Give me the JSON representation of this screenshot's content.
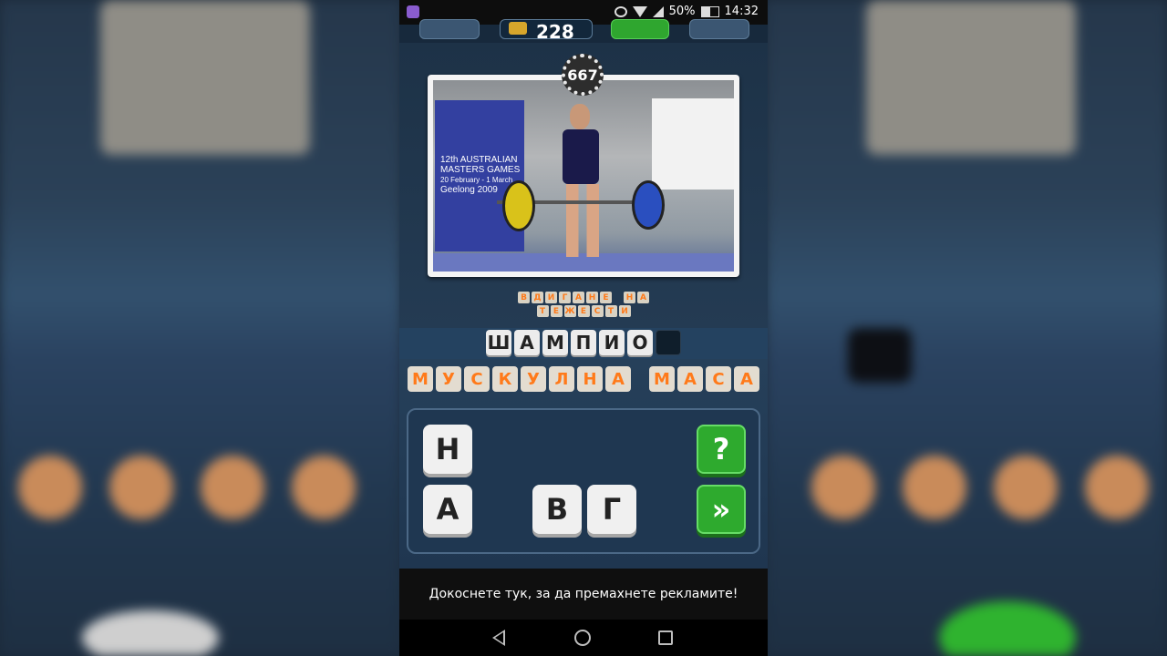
{
  "status_bar": {
    "battery": "50%",
    "time": "14:32"
  },
  "header": {
    "coins": "228",
    "add_label": "+"
  },
  "level": {
    "number": "667"
  },
  "photo": {
    "banner_lines": [
      "12th AUSTRALIAN",
      "MASTERS GAMES",
      "20 February - 1 March",
      "Geelong 2009"
    ]
  },
  "clue_words": [
    [
      "В",
      "Д",
      "И",
      "Г",
      "А",
      "Н",
      "Е",
      " ",
      "Н",
      "А"
    ],
    [
      "Т",
      "Е",
      "Ж",
      "Е",
      "С",
      "Т",
      "И"
    ]
  ],
  "answer_letters": [
    "Ш",
    "А",
    "М",
    "П",
    "И",
    "О"
  ],
  "guessed_words": [
    "М",
    "У",
    "С",
    "К",
    "У",
    "Л",
    "Н",
    "А",
    " ",
    "М",
    "А",
    "С",
    "А"
  ],
  "letter_buttons": {
    "h": "Н",
    "a": "А",
    "v": "В",
    "g": "Г",
    "hint": "?",
    "skip": "»"
  },
  "ad_text": "Докоснете тук, за да премахнете рекламите!",
  "colors": {
    "accent_orange": "#ff7a1a",
    "green_button": "#2eaa2e"
  }
}
